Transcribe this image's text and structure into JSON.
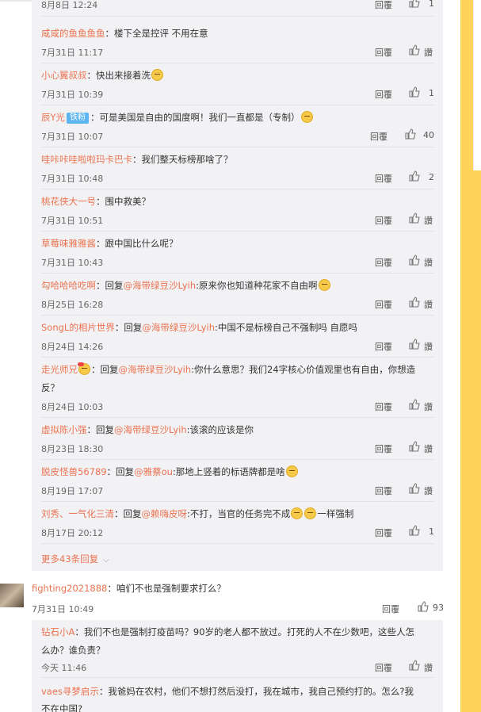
{
  "reply_label": "回覆",
  "like_label": "讚",
  "colors": {
    "username": "#eb7350",
    "background_strip": "#fdd35a",
    "reply_area": "#f2f2f5"
  },
  "top_partial": {
    "time": "8月8日 12:24",
    "likes": "1"
  },
  "replies": [
    {
      "user": "咸咸的鱼鱼鱼鱼",
      "text": "楼下全是控评 不用在意",
      "time": "7月31日 11:17",
      "likes": "讚"
    },
    {
      "user": "小心翼叔叔",
      "text": "快出来接着洗",
      "time": "7月31日 10:39",
      "likes": "1"
    },
    {
      "user": "辰Y光",
      "badge": "铁粉",
      "text": "可是美国是自由的国度啊！我们一直都是（专制）",
      "time": "7月31日 10:07",
      "likes": "40"
    },
    {
      "user": "哇咔咔哇啦啦玛卡巴卡",
      "text": "我们整天标榜那啥了？",
      "time": "7月31日 10:48",
      "likes": "2"
    },
    {
      "user": "桃花侠大一号",
      "text": "围中救美？",
      "time": "7月31日 10:51",
      "likes": "讚"
    },
    {
      "user": "草莓味雅雅酱",
      "text": "跟中国比什么呢？",
      "time": "7月31日 10:43",
      "likes": "讚"
    },
    {
      "user": "勾哈哈哈吃啊",
      "prefix": "回复",
      "mention": "@海带绿豆沙Lyih",
      "text": ":原来你也知道种花家不自由啊",
      "time": "8月25日 16:28",
      "likes": "讚"
    },
    {
      "user": "SongL的相片世界",
      "prefix": "回复",
      "mention": "@海带绿豆沙Lyih",
      "text": ":中国不是标榜自己不强制吗 自愿吗",
      "time": "8月24日 14:26",
      "likes": "讚"
    },
    {
      "user": "走光师兄",
      "prefix": "回复",
      "mention": "@海带绿豆沙Lyih",
      "text": ":你什么意思？我们24字核心价值观里也有自由，你想造",
      "text2": "反？",
      "time": "8月24日 10:03",
      "likes": "讚"
    },
    {
      "user": "虚拟陈小强",
      "prefix": "回复",
      "mention": "@海带绿豆沙Lyih",
      "text": ":该滚的应该是你",
      "time": "8月23日 18:30",
      "likes": "讚"
    },
    {
      "user": "脱皮怪兽56789",
      "prefix": "回复",
      "mention": "@雅蔡ou",
      "text": ":那地上竖着的标语牌都是啥",
      "time": "8月19日 17:07",
      "likes": "讚"
    },
    {
      "user": "刘秀、一气化三清",
      "prefix": "回复",
      "mention": "@赖嗨皮呀",
      "text": ":不打，当官的任务完不成",
      "text_after": "一样强制",
      "time": "8月17日 20:12",
      "likes": "1"
    }
  ],
  "more_replies": "更多43条回复",
  "main_comment": {
    "user": "fighting2021888",
    "text": "咱们不也是强制要求打么？",
    "time": "7月31日 10:49",
    "likes": "93"
  },
  "sub_replies": [
    {
      "user": "钻石小A",
      "text": "我们不也是强制打疫苗吗？90岁的老人都不放过。打死的人不在少数吧，这些人怎",
      "text2": "么办？谁负责？",
      "time": "今天 11:46",
      "likes": "讚"
    },
    {
      "user": "vaes寻梦启示",
      "text": "我爸妈在农村，他们不想打然后没打，我在城市，我自己预约打的。怎么?我",
      "text2": "不在中国?"
    }
  ]
}
